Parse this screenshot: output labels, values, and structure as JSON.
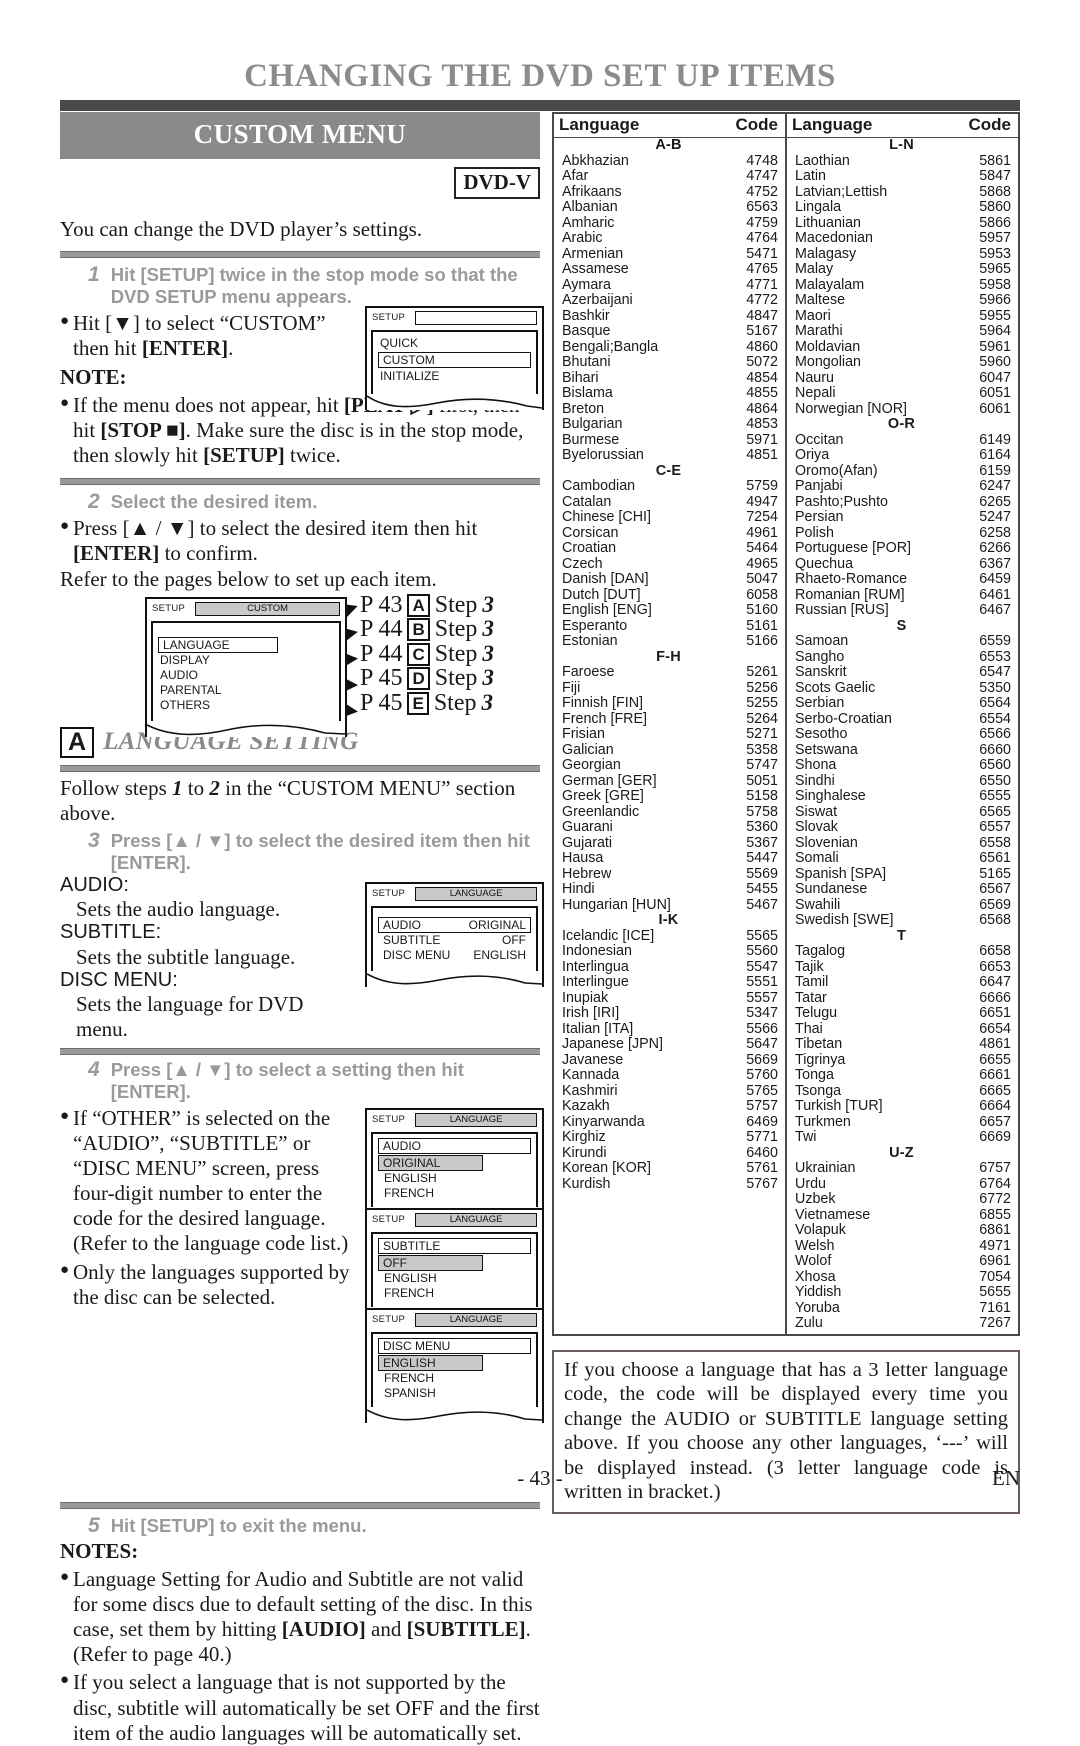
{
  "header": {
    "title": "CHANGING THE DVD SET UP ITEMS"
  },
  "left": {
    "section_title": "CUSTOM MENU",
    "badge": "DVD-V",
    "lead": "You can change the DVD player’s settings.",
    "step1": {
      "num": "1",
      "text": "Hit [SETUP] twice in the stop mode so that the DVD SETUP menu appears.",
      "bullet": "Hit [▼] to select “CUSTOM” then hit [ENTER].",
      "bullet_pre": "Hit [▼] to select “CUSTOM” then hit ",
      "bullet_bold": "[ENTER]",
      "bullet_post": "."
    },
    "note_heading": "NOTE:",
    "note1_a": "If the menu does not appear, hit ",
    "note1_b": "[PLAY ▷]",
    "note1_c": " first, then hit ",
    "note1_d": "[STOP ■]",
    "note1_e": ". Make sure the disc is in the stop mode, then slowly hit ",
    "note1_f": "[SETUP]",
    "note1_g": " twice.",
    "osd1": {
      "title": "SETUP",
      "field": "",
      "rows": [
        "QUICK",
        "CUSTOM",
        "INITIALIZE"
      ],
      "selected": "CUSTOM"
    },
    "step2": {
      "num": "2",
      "text": "Select the desired item.",
      "bullet_a": "Press [▲ / ▼] to select the desired item then hit ",
      "bullet_b": "[ENTER]",
      "bullet_c": " to confirm.",
      "refer": "Refer to the pages below to set up each item."
    },
    "osd2": {
      "title": "SETUP",
      "field": "CUSTOM",
      "rows": [
        "LANGUAGE",
        "DISPLAY",
        "AUDIO",
        "PARENTAL",
        "OTHERS"
      ],
      "selected": "LANGUAGE"
    },
    "page_map": [
      {
        "page": "P 43",
        "letter": "A",
        "step": "Step",
        "stepnum": "3"
      },
      {
        "page": "P 44",
        "letter": "B",
        "step": "Step",
        "stepnum": "3"
      },
      {
        "page": "P 44",
        "letter": "C",
        "step": "Step",
        "stepnum": "3"
      },
      {
        "page": "P 45",
        "letter": "D",
        "step": "Step",
        "stepnum": "3"
      },
      {
        "page": "P 45",
        "letter": "E",
        "step": "Step",
        "stepnum": "3"
      }
    ],
    "sectionA": {
      "letter": "A",
      "title": "LANGUAGE SETTING"
    },
    "follow_a": "Follow steps ",
    "follow_1": "1",
    "follow_b": " to ",
    "follow_2": "2",
    "follow_c": " in the “CUSTOM MENU” section above.",
    "step3": {
      "num": "3",
      "text": "Press [▲ / ▼] to select the desired item then hit [ENTER]."
    },
    "items": [
      {
        "key": "AUDIO:",
        "desc": "Sets the audio language."
      },
      {
        "key": "SUBTITLE:",
        "desc": "Sets the subtitle language."
      },
      {
        "key": "DISC MENU:",
        "desc": "Sets the language for DVD menu."
      }
    ],
    "osd3": {
      "title": "SETUP",
      "field": "LANGUAGE",
      "rows": [
        {
          "name": "AUDIO",
          "value": "ORIGINAL"
        },
        {
          "name": "SUBTITLE",
          "value": "OFF"
        },
        {
          "name": "DISC MENU",
          "value": "ENGLISH"
        }
      ],
      "selected": "AUDIO"
    },
    "step4": {
      "num": "4",
      "text": "Press [▲ / ▼] to select a setting then hit [ENTER]."
    },
    "step4_bullet1": "If “OTHER” is selected on the “AUDIO”, “SUBTITLE” or “DISC MENU” screen, press four-digit number to enter the code for the desired language. (Refer to the language code list.)",
    "step4_bullet2": "Only the languages supported by the disc can be selected.",
    "osd4": {
      "title": "SETUP",
      "field": "LANGUAGE",
      "head": "AUDIO",
      "rows": [
        "ORIGINAL",
        "ENGLISH",
        "FRENCH"
      ],
      "selected": "ORIGINAL"
    },
    "osd5": {
      "title": "SETUP",
      "field": "LANGUAGE",
      "head": "SUBTITLE",
      "rows": [
        "OFF",
        "ENGLISH",
        "FRENCH"
      ],
      "selected": "OFF"
    },
    "osd6": {
      "title": "SETUP",
      "field": "LANGUAGE",
      "head": "DISC MENU",
      "rows": [
        "ENGLISH",
        "FRENCH",
        "SPANISH"
      ],
      "selected": "ENGLISH"
    },
    "step5": {
      "num": "5",
      "text": "Hit [SETUP] to exit the menu."
    },
    "notes_heading": "NOTES:",
    "note2_a": "Language Setting for Audio and Subtitle are not valid for some discs due to default setting of the disc. In this case, set them by hitting ",
    "note2_b": "[AUDIO]",
    "note2_c": " and ",
    "note2_d": "[SUBTITLE]",
    "note2_e": ". (Refer to page 40.)",
    "note3": "If you select a language that is not supported by the disc, subtitle will automatically be set OFF and the first item of the audio languages will be automatically set."
  },
  "table": {
    "head_language": "Language",
    "head_code": "Code",
    "columns": [
      {
        "groups": [
          {
            "label": "A-B",
            "rows": [
              [
                "Abkhazian",
                "4748"
              ],
              [
                "Afar",
                "4747"
              ],
              [
                "Afrikaans",
                "4752"
              ],
              [
                "Albanian",
                "6563"
              ],
              [
                "Amharic",
                "4759"
              ],
              [
                "Arabic",
                "4764"
              ],
              [
                "Armenian",
                "5471"
              ],
              [
                "Assamese",
                "4765"
              ],
              [
                "Aymara",
                "4771"
              ],
              [
                "Azerbaijani",
                "4772"
              ],
              [
                "Bashkir",
                "4847"
              ],
              [
                "Basque",
                "5167"
              ],
              [
                "Bengali;Bangla",
                "4860"
              ],
              [
                "Bhutani",
                "5072"
              ],
              [
                "Bihari",
                "4854"
              ],
              [
                "Bislama",
                "4855"
              ],
              [
                "Breton",
                "4864"
              ],
              [
                "Bulgarian",
                "4853"
              ],
              [
                "Burmese",
                "5971"
              ],
              [
                "Byelorussian",
                "4851"
              ]
            ]
          },
          {
            "label": "C-E",
            "rows": [
              [
                "Cambodian",
                "5759"
              ],
              [
                "Catalan",
                "4947"
              ],
              [
                "Chinese [CHI]",
                "7254"
              ],
              [
                "Corsican",
                "4961"
              ],
              [
                "Croatian",
                "5464"
              ],
              [
                "Czech",
                "4965"
              ],
              [
                "Danish [DAN]",
                "5047"
              ],
              [
                "Dutch [DUT]",
                "6058"
              ],
              [
                "English [ENG]",
                "5160"
              ],
              [
                "Esperanto",
                "5161"
              ],
              [
                "Estonian",
                "5166"
              ]
            ]
          },
          {
            "label": "F-H",
            "rows": [
              [
                "Faroese",
                "5261"
              ],
              [
                "Fiji",
                "5256"
              ],
              [
                "Finnish [FIN]",
                "5255"
              ],
              [
                "French [FRE]",
                "5264"
              ],
              [
                "Frisian",
                "5271"
              ],
              [
                "Galician",
                "5358"
              ],
              [
                "Georgian",
                "5747"
              ],
              [
                "German [GER]",
                "5051"
              ],
              [
                "Greek [GRE]",
                "5158"
              ],
              [
                "Greenlandic",
                "5758"
              ],
              [
                "Guarani",
                "5360"
              ],
              [
                "Gujarati",
                "5367"
              ],
              [
                "Hausa",
                "5447"
              ],
              [
                "Hebrew",
                "5569"
              ],
              [
                "Hindi",
                "5455"
              ],
              [
                "Hungarian [HUN]",
                "5467"
              ]
            ]
          },
          {
            "label": "I-K",
            "rows": [
              [
                "Icelandic [ICE]",
                "5565"
              ],
              [
                "Indonesian",
                "5560"
              ],
              [
                "Interlingua",
                "5547"
              ],
              [
                "Interlingue",
                "5551"
              ],
              [
                "Inupiak",
                "5557"
              ],
              [
                "Irish [IRI]",
                "5347"
              ],
              [
                "Italian [ITA]",
                "5566"
              ],
              [
                "Japanese [JPN]",
                "5647"
              ],
              [
                "Javanese",
                "5669"
              ],
              [
                "Kannada",
                "5760"
              ],
              [
                "Kashmiri",
                "5765"
              ],
              [
                "Kazakh",
                "5757"
              ],
              [
                "Kinyarwanda",
                "6469"
              ],
              [
                "Kirghiz",
                "5771"
              ],
              [
                "Kirundi",
                "6460"
              ],
              [
                "Korean [KOR]",
                "5761"
              ],
              [
                "Kurdish",
                "5767"
              ]
            ]
          }
        ]
      },
      {
        "groups": [
          {
            "label": "L-N",
            "rows": [
              [
                "Laothian",
                "5861"
              ],
              [
                "Latin",
                "5847"
              ],
              [
                "Latvian;Lettish",
                "5868"
              ],
              [
                "Lingala",
                "5860"
              ],
              [
                "Lithuanian",
                "5866"
              ],
              [
                "Macedonian",
                "5957"
              ],
              [
                "Malagasy",
                "5953"
              ],
              [
                "Malay",
                "5965"
              ],
              [
                "Malayalam",
                "5958"
              ],
              [
                "Maltese",
                "5966"
              ],
              [
                "Maori",
                "5955"
              ],
              [
                "Marathi",
                "5964"
              ],
              [
                "Moldavian",
                "5961"
              ],
              [
                "Mongolian",
                "5960"
              ],
              [
                "Nauru",
                "6047"
              ],
              [
                "Nepali",
                "6051"
              ],
              [
                "Norwegian [NOR]",
                "6061"
              ]
            ]
          },
          {
            "label": "O-R",
            "rows": [
              [
                "Occitan",
                "6149"
              ],
              [
                "Oriya",
                "6164"
              ],
              [
                "Oromo(Afan)",
                "6159"
              ],
              [
                "Panjabi",
                "6247"
              ],
              [
                "Pashto;Pushto",
                "6265"
              ],
              [
                "Persian",
                "5247"
              ],
              [
                "Polish",
                "6258"
              ],
              [
                "Portuguese [POR]",
                "6266"
              ],
              [
                "Quechua",
                "6367"
              ],
              [
                "Rhaeto-Romance",
                "6459"
              ],
              [
                "Romanian [RUM]",
                "6461"
              ],
              [
                "Russian [RUS]",
                "6467"
              ]
            ]
          },
          {
            "label": "S",
            "rows": [
              [
                "Samoan",
                "6559"
              ],
              [
                "Sangho",
                "6553"
              ],
              [
                "Sanskrit",
                "6547"
              ],
              [
                "Scots Gaelic",
                "5350"
              ],
              [
                "Serbian",
                "6564"
              ],
              [
                "Serbo-Croatian",
                "6554"
              ],
              [
                "Sesotho",
                "6566"
              ],
              [
                "Setswana",
                "6660"
              ],
              [
                "Shona",
                "6560"
              ],
              [
                "Sindhi",
                "6550"
              ],
              [
                "Singhalese",
                "6555"
              ],
              [
                "Siswat",
                "6565"
              ],
              [
                "Slovak",
                "6557"
              ],
              [
                "Slovenian",
                "6558"
              ],
              [
                "Somali",
                "6561"
              ],
              [
                "Spanish [SPA]",
                "5165"
              ],
              [
                "Sundanese",
                "6567"
              ],
              [
                "Swahili",
                "6569"
              ],
              [
                "Swedish [SWE]",
                "6568"
              ]
            ]
          },
          {
            "label": "T",
            "rows": [
              [
                "Tagalog",
                "6658"
              ],
              [
                "Tajik",
                "6653"
              ],
              [
                "Tamil",
                "6647"
              ],
              [
                "Tatar",
                "6666"
              ],
              [
                "Telugu",
                "6651"
              ],
              [
                "Thai",
                "6654"
              ],
              [
                "Tibetan",
                "4861"
              ],
              [
                "Tigrinya",
                "6655"
              ],
              [
                "Tonga",
                "6661"
              ],
              [
                "Tsonga",
                "6665"
              ],
              [
                "Turkish [TUR]",
                "6664"
              ],
              [
                "Turkmen",
                "6657"
              ],
              [
                "Twi",
                "6669"
              ]
            ]
          },
          {
            "label": "U-Z",
            "rows": [
              [
                "Ukrainian",
                "6757"
              ],
              [
                "Urdu",
                "6764"
              ],
              [
                "Uzbek",
                "6772"
              ],
              [
                "Vietnamese",
                "6855"
              ],
              [
                "Volapuk",
                "6861"
              ],
              [
                "Welsh",
                "4971"
              ],
              [
                "Wolof",
                "6961"
              ],
              [
                "Xhosa",
                "7054"
              ],
              [
                "Yiddish",
                "5655"
              ],
              [
                "Yoruba",
                "7161"
              ],
              [
                "Zulu",
                "7267"
              ]
            ]
          }
        ]
      }
    ]
  },
  "notebox": "If you choose a language that has a 3 letter language code, the code will be displayed every time you change the AUDIO or SUBTITLE language setting above. If you choose any other languages, ‘---’ will be displayed instead. (3 letter language code is written in bracket.)",
  "footer": {
    "page": "- 43 -",
    "lang": "EN"
  },
  "colors": {
    "accent_grey": "#8a8a8a",
    "rule": "#4a4a4a",
    "notebox_border": "#6a5a62"
  }
}
